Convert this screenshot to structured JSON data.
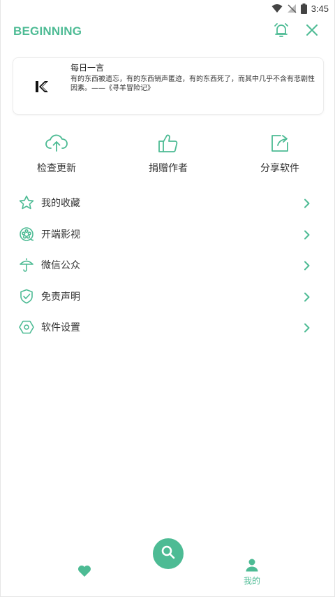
{
  "status_bar": {
    "time": "3:45"
  },
  "header": {
    "title": "BEGINNING"
  },
  "quote": {
    "title": "每日一言",
    "text": "有的东西被遗忘，有的东西销声匿迹，有的东西死了，而其中几乎不含有悲剧性因素。——《寻羊冒险记》"
  },
  "actions": [
    {
      "label": "检查更新",
      "icon": "cloud-upload-icon"
    },
    {
      "label": "捐赠作者",
      "icon": "thumbs-up-icon"
    },
    {
      "label": "分享软件",
      "icon": "share-icon"
    }
  ],
  "menu": [
    {
      "label": "我的收藏",
      "icon": "star-icon"
    },
    {
      "label": "开端影视",
      "icon": "film-reel-icon"
    },
    {
      "label": "微信公众",
      "icon": "umbrella-icon"
    },
    {
      "label": "免责声明",
      "icon": "shield-check-icon"
    },
    {
      "label": "软件设置",
      "icon": "hexagon-settings-icon"
    }
  ],
  "bottom_nav": {
    "me_label": "我的"
  },
  "colors": {
    "accent": "#4dbb94",
    "text": "#333333"
  }
}
